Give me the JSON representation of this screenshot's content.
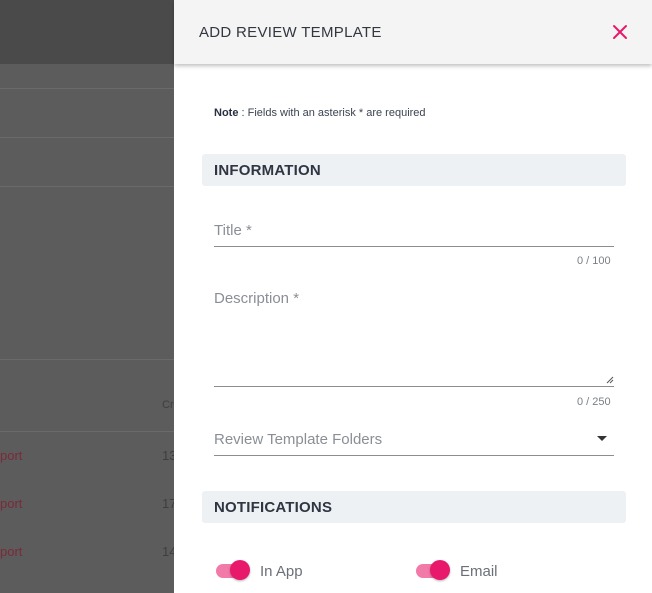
{
  "background": {
    "rows": [
      {
        "link": "port",
        "value": "13"
      },
      {
        "link": "port",
        "value": "17"
      },
      {
        "link": "port",
        "value": "14"
      }
    ],
    "column_header": "Cr"
  },
  "drawer": {
    "title": "ADD REVIEW TEMPLATE",
    "note_bold": "Note",
    "note_text": " : Fields with an asterisk * are required",
    "sections": {
      "information": "INFORMATION",
      "notifications": "NOTIFICATIONS"
    },
    "fields": {
      "title_label": "Title *",
      "title_counter": "0 / 100",
      "description_label": "Description *",
      "description_counter": "0 / 250",
      "folders_label": "Review Template Folders"
    },
    "toggles": [
      {
        "label": "In App",
        "on": true
      },
      {
        "label": "Email",
        "on": true
      }
    ],
    "accent_color": "#e8196b"
  }
}
